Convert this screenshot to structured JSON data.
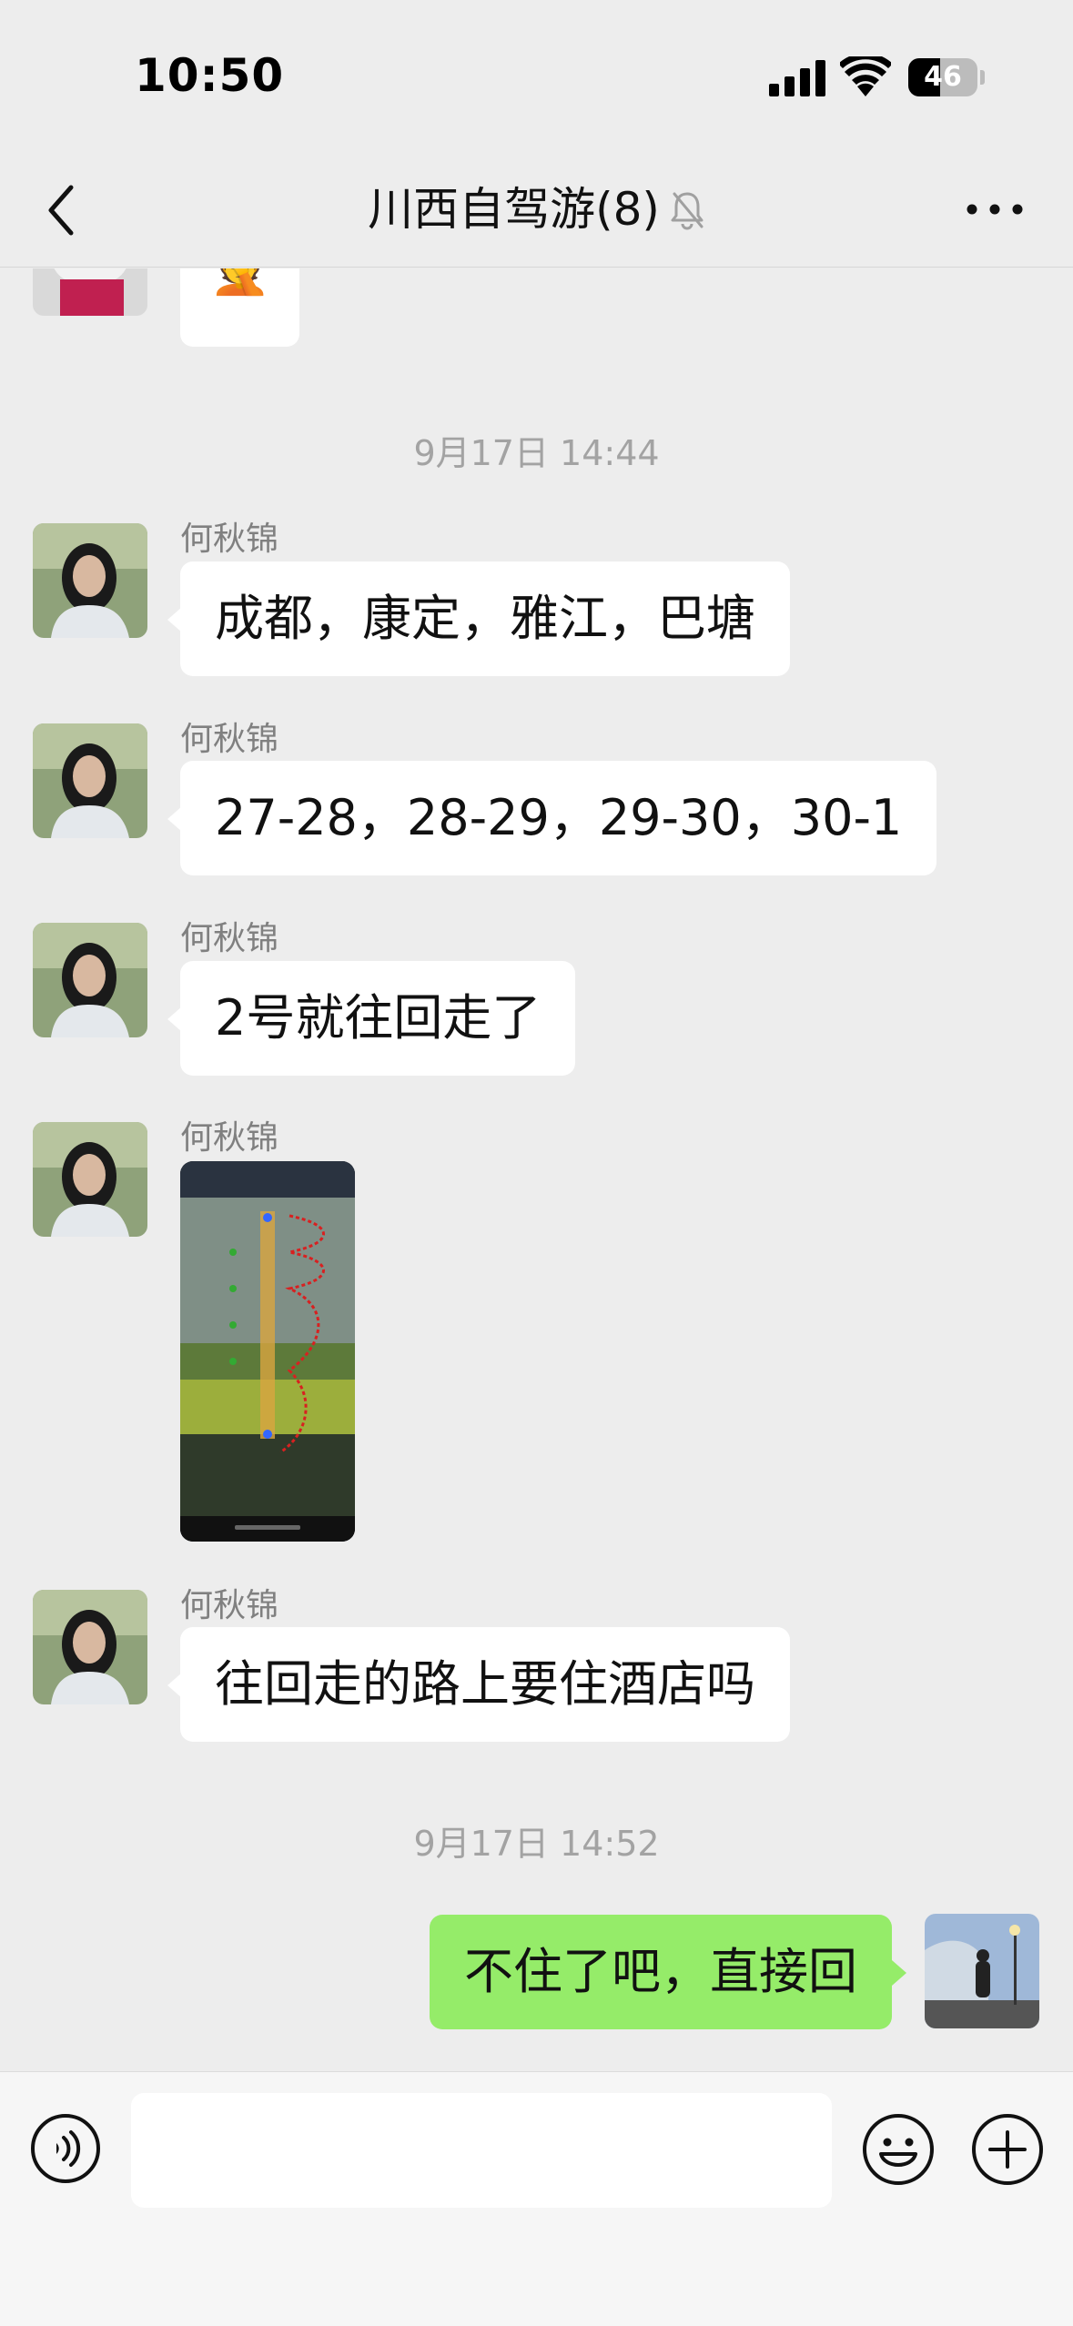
{
  "status_bar": {
    "time": "10:50",
    "battery": "46",
    "battery_level": 0.46
  },
  "header": {
    "title": "川西自驾游(8)",
    "icons": [
      "chevron-left-icon",
      "bell-muted-icon",
      "more-dots-icon"
    ]
  },
  "messages": {
    "partial_emoji": "🤦",
    "timestamp_1": "9月17日 14:44",
    "m1": {
      "sender": "何秋锦",
      "text": "成都，康定，雅江，巴塘"
    },
    "m2": {
      "sender": "何秋锦",
      "text": "27-28，28-29，29-30，30-1"
    },
    "m3": {
      "sender": "何秋锦",
      "text": "2号就往回走了"
    },
    "m4": {
      "sender": "何秋锦",
      "type": "image"
    },
    "m5": {
      "sender": "何秋锦",
      "text": "往回走的路上要住酒店吗"
    },
    "timestamp_2": "9月17日 14:52",
    "m6": {
      "sender": "self",
      "text": "不住了吧，直接回"
    }
  },
  "input_bar": {
    "placeholder": "",
    "icons": [
      "voice-icon",
      "emoji-icon",
      "plus-icon"
    ]
  },
  "colors": {
    "background": "#ededed",
    "self_bubble": "#95ec69",
    "other_bubble": "#ffffff"
  }
}
